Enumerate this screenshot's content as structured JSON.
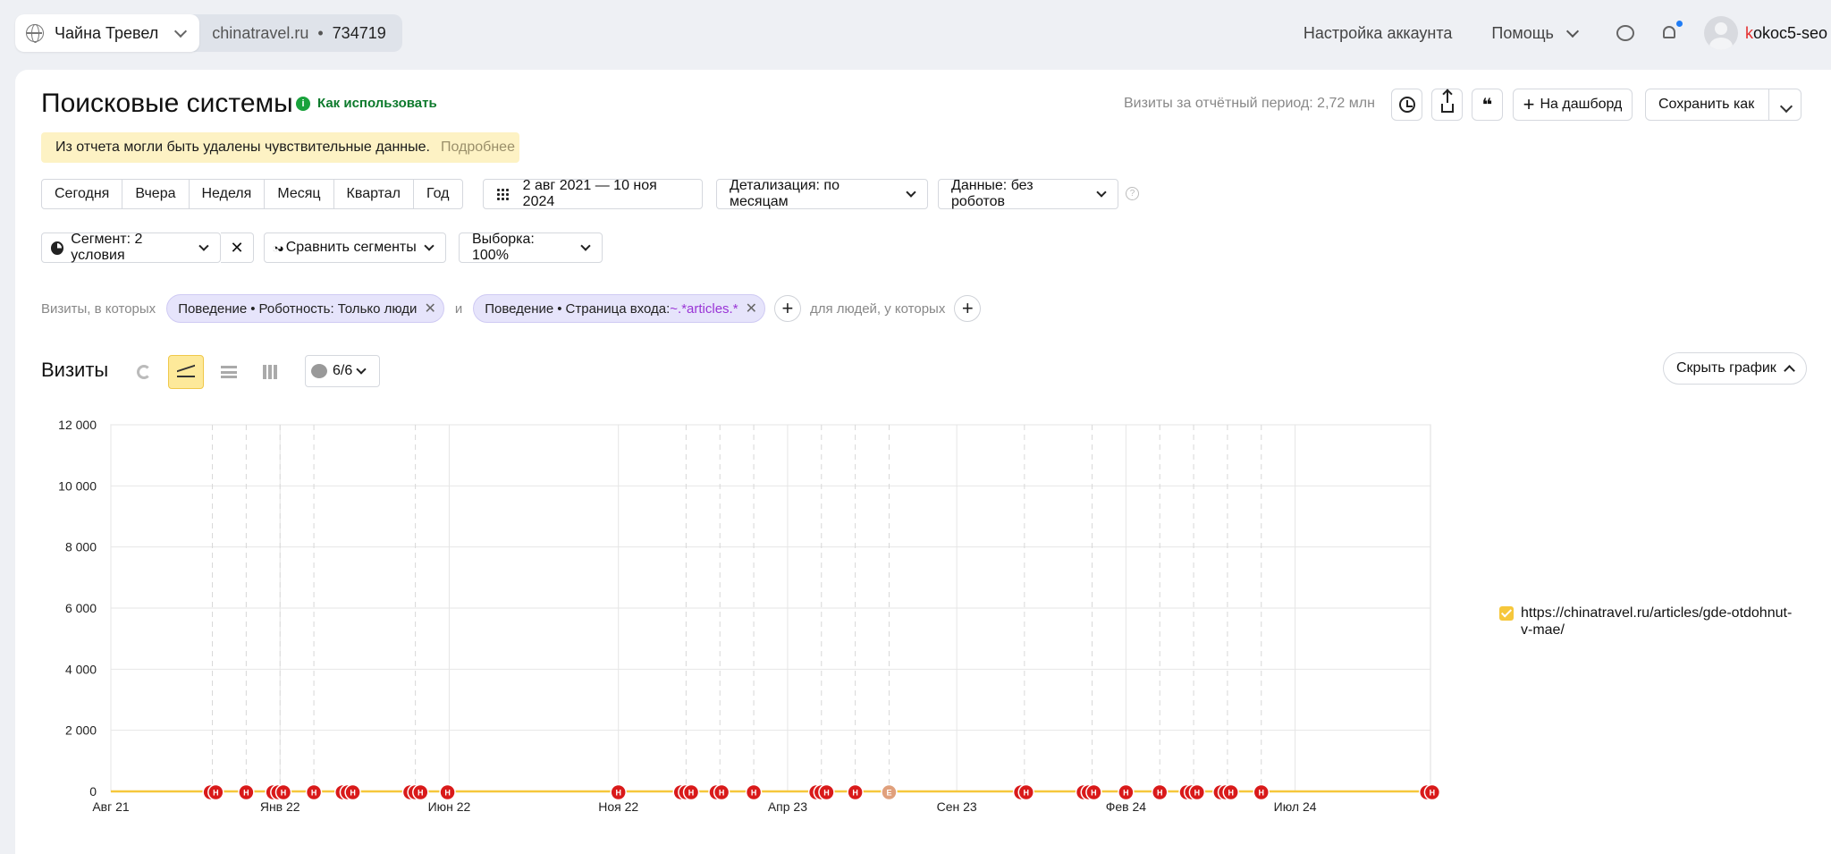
{
  "topbar": {
    "counter_name": "Чайна Тревел",
    "counter_domain": "chinatravel.ru",
    "counter_sep": "•",
    "counter_id": "734719",
    "account_settings": "Настройка аккаунта",
    "help": "Помощь",
    "username_first": "k",
    "username_rest": "okoc5-seo"
  },
  "header": {
    "title": "Поисковые системы",
    "how_to_use": "Как использовать",
    "visits_period": "Визиты за отчётный период: 2,72 млн",
    "quote_icon": "❝",
    "to_dashboard": "На дашборд",
    "save_as": "Сохранить как"
  },
  "notice": {
    "text": "Из отчета могли быть удалены чувствительные данные.",
    "more": "Подробнее"
  },
  "periods": [
    "Сегодня",
    "Вчера",
    "Неделя",
    "Месяц",
    "Квартал",
    "Год"
  ],
  "date_range": "2 авг 2021 — 10 ноя 2024",
  "detail": "Детализация: по месяцам",
  "data_filter": "Данные: без роботов",
  "segment": {
    "label": "Сегмент: 2 условия",
    "compare": "Сравнить сегменты",
    "sample": "Выборка: 100%"
  },
  "filters": {
    "prefix": "Визиты, в которых",
    "chip1": {
      "group": "Поведение",
      "sep": "•",
      "text": "Роботность: Только люди"
    },
    "conj": "и",
    "chip2": {
      "group": "Поведение",
      "sep": "•",
      "text": "Страница входа: ",
      "value": "~.*articles.*"
    },
    "people": "для людей, у которых"
  },
  "section": {
    "title": "Визиты",
    "notes": "6/6",
    "hide_chart": "Скрыть график"
  },
  "colors": {
    "series": "#f6c73b",
    "note_marker": "#d91a1a",
    "note_marker_event": "#e0a07c",
    "grid": "#e6e6e6"
  },
  "chart_data": {
    "type": "line",
    "x": [
      "2021-08",
      "2021-09",
      "2021-10",
      "2021-11",
      "2021-12",
      "2022-01",
      "2022-02",
      "2022-03",
      "2022-04",
      "2022-05",
      "2022-06",
      "2022-07",
      "2022-08",
      "2022-09",
      "2022-10",
      "2022-11",
      "2022-12",
      "2023-01",
      "2023-02",
      "2023-03",
      "2023-04",
      "2023-05",
      "2023-06",
      "2023-07",
      "2023-08",
      "2023-09",
      "2023-10",
      "2023-11",
      "2023-12",
      "2024-01",
      "2024-02",
      "2024-03",
      "2024-04",
      "2024-05",
      "2024-06",
      "2024-07",
      "2024-08",
      "2024-09",
      "2024-10",
      "2024-11"
    ],
    "x_tick_labels": [
      {
        "label": "Авг 21",
        "index": 0
      },
      {
        "label": "Янв 22",
        "index": 5
      },
      {
        "label": "Июн 22",
        "index": 10
      },
      {
        "label": "Ноя 22",
        "index": 15
      },
      {
        "label": "Апр 23",
        "index": 20
      },
      {
        "label": "Сен 23",
        "index": 25
      },
      {
        "label": "Фев 24",
        "index": 30
      },
      {
        "label": "Июл 24",
        "index": 35
      }
    ],
    "series": [
      {
        "name": "https://chinatravel.ru/articles/gde-otdohnut-v-mae/",
        "values": [
          0,
          0,
          0,
          0,
          0,
          0,
          0,
          0,
          0,
          0,
          0,
          0,
          0,
          0,
          0,
          0,
          0,
          0,
          0,
          0,
          0,
          0,
          0,
          0,
          0,
          0,
          0,
          0,
          0,
          0,
          0,
          0,
          0,
          0,
          0,
          0,
          0,
          0,
          0,
          0
        ]
      }
    ],
    "ylim": [
      0,
      12000
    ],
    "y_ticks": [
      "0",
      "2 000",
      "4 000",
      "6 000",
      "8 000",
      "10 000",
      "12 000"
    ],
    "grid": true,
    "legend_position": "right",
    "notes": [
      {
        "label": "Н",
        "x": 2.95,
        "kind": "note"
      },
      {
        "label": "Н",
        "x": 3.1,
        "kind": "note"
      },
      {
        "label": "Н",
        "x": 4.0,
        "kind": "note"
      },
      {
        "label": "Н",
        "x": 4.8,
        "kind": "note"
      },
      {
        "label": "Н",
        "x": 4.95,
        "kind": "note"
      },
      {
        "label": "Н",
        "x": 5.1,
        "kind": "note"
      },
      {
        "label": "Н",
        "x": 6.0,
        "kind": "note"
      },
      {
        "label": "Н",
        "x": 6.85,
        "kind": "note"
      },
      {
        "label": "Н",
        "x": 7.0,
        "kind": "note"
      },
      {
        "label": "Н",
        "x": 7.15,
        "kind": "note"
      },
      {
        "label": "Н",
        "x": 8.85,
        "kind": "note"
      },
      {
        "label": "Н",
        "x": 9.0,
        "kind": "note"
      },
      {
        "label": "Н",
        "x": 9.15,
        "kind": "note"
      },
      {
        "label": "Н",
        "x": 9.95,
        "kind": "note"
      },
      {
        "label": "Н",
        "x": 15.0,
        "kind": "note"
      },
      {
        "label": "Н",
        "x": 16.85,
        "kind": "note"
      },
      {
        "label": "Н",
        "x": 17.0,
        "kind": "note"
      },
      {
        "label": "Н",
        "x": 17.15,
        "kind": "note"
      },
      {
        "label": "Н",
        "x": 17.9,
        "kind": "note"
      },
      {
        "label": "Н",
        "x": 18.05,
        "kind": "note"
      },
      {
        "label": "Н",
        "x": 19.0,
        "kind": "note"
      },
      {
        "label": "Н",
        "x": 20.85,
        "kind": "note"
      },
      {
        "label": "Н",
        "x": 21.0,
        "kind": "note"
      },
      {
        "label": "Н",
        "x": 21.15,
        "kind": "note"
      },
      {
        "label": "Н",
        "x": 22.0,
        "kind": "note"
      },
      {
        "label": "Е",
        "x": 23.0,
        "kind": "event"
      },
      {
        "label": "Н",
        "x": 26.9,
        "kind": "note"
      },
      {
        "label": "Н",
        "x": 27.05,
        "kind": "note"
      },
      {
        "label": "Н",
        "x": 28.75,
        "kind": "note"
      },
      {
        "label": "Н",
        "x": 28.9,
        "kind": "note"
      },
      {
        "label": "Н",
        "x": 29.05,
        "kind": "note"
      },
      {
        "label": "Н",
        "x": 30.0,
        "kind": "note"
      },
      {
        "label": "Н",
        "x": 31.0,
        "kind": "note"
      },
      {
        "label": "Н",
        "x": 31.8,
        "kind": "note"
      },
      {
        "label": "Н",
        "x": 31.95,
        "kind": "note"
      },
      {
        "label": "Н",
        "x": 32.1,
        "kind": "note"
      },
      {
        "label": "Н",
        "x": 32.8,
        "kind": "note"
      },
      {
        "label": "Н",
        "x": 32.95,
        "kind": "note"
      },
      {
        "label": "Н",
        "x": 33.1,
        "kind": "note"
      },
      {
        "label": "Н",
        "x": 34.0,
        "kind": "note"
      },
      {
        "label": "Н",
        "x": 38.9,
        "kind": "note"
      },
      {
        "label": "Н",
        "x": 39.05,
        "kind": "note"
      }
    ],
    "note_lines": [
      3,
      4,
      5,
      6,
      9,
      17,
      18,
      19,
      21,
      22,
      23,
      27,
      29,
      31,
      32,
      33,
      34
    ]
  }
}
